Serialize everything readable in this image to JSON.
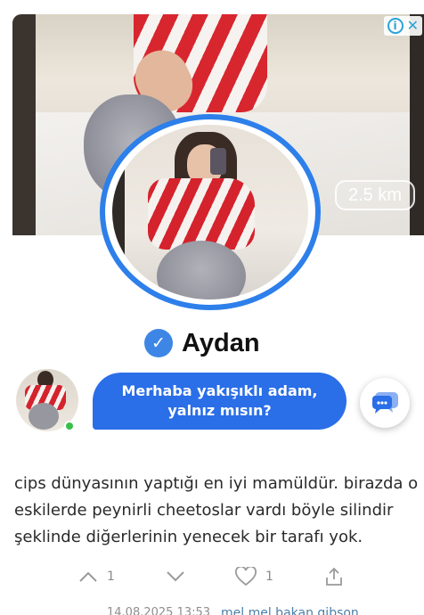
{
  "ad": {
    "distance": "2.5 km",
    "profile_name": "Aydan",
    "message_line1": "Merhaba yakışıklı adam,",
    "message_line2": "yalnız mısın?",
    "colors": {
      "accent_blue": "#2d7fea",
      "bubble_blue": "#2a6ee8",
      "online_green": "#39c04a"
    },
    "icons": {
      "info": "info-icon",
      "close": "close-icon",
      "verified": "verified-check-icon",
      "chat": "chat-bubble-icon"
    }
  },
  "entry": {
    "lines": [
      "cips dünyasının yaptığı en iyi mamüldür. birazda o",
      "eskilerde peynirli cheetoslar vardı böyle silindir",
      "şeklinde diğerlerinin yenecek bir tarafı yok."
    ]
  },
  "actions": {
    "upvote_count": "1",
    "favorite_count": "1",
    "icons": {
      "upvote": "chevron-up-icon",
      "downvote": "chevron-down-icon",
      "favorite": "heart-icon",
      "share": "share-icon"
    }
  },
  "footer": {
    "date": "14.08.2025 13:53",
    "author": "mel mel bakan gibson"
  }
}
